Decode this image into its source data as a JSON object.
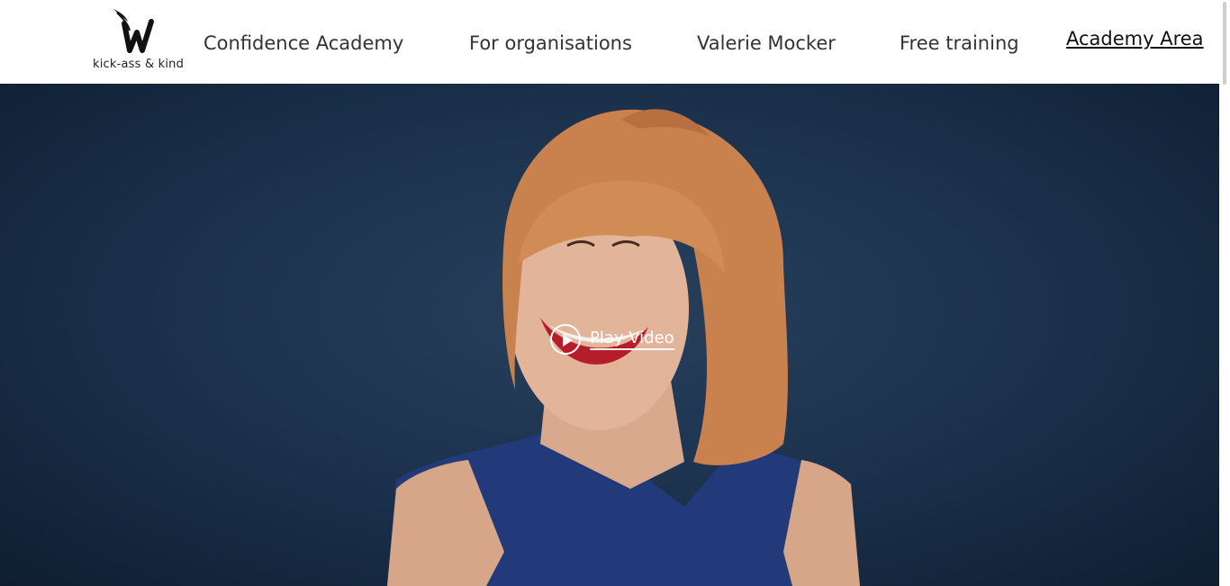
{
  "logo": {
    "tagline": "kick-ass & kind",
    "icon": "winged-w-logo"
  },
  "nav": {
    "items": [
      {
        "label": "Confidence Academy"
      },
      {
        "label": "For organisations"
      },
      {
        "label": "Valerie Mocker"
      },
      {
        "label": "Free training"
      }
    ],
    "academy_link": "Academy Area"
  },
  "hero": {
    "play_label": "Play Video",
    "play_icon": "play-circle-icon",
    "background_color": "#1e3551"
  }
}
